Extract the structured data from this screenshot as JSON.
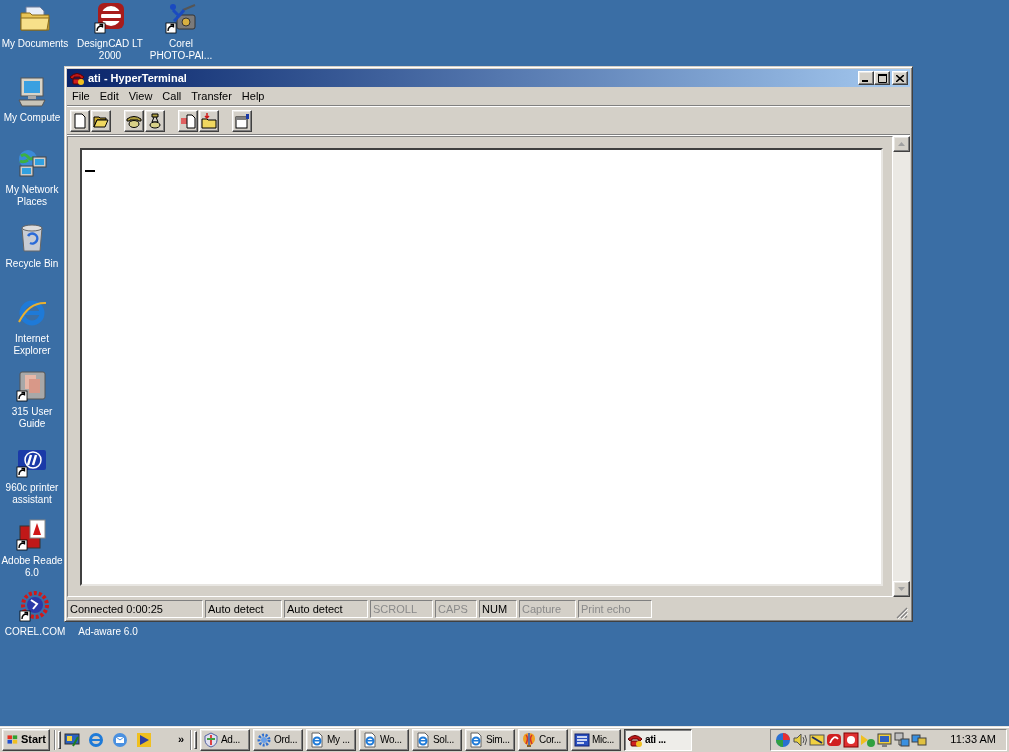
{
  "desktop": {
    "icons": [
      {
        "label": "My Documents",
        "kind": "folder",
        "shortcut": false
      },
      {
        "label": "DesignCAD LT\n2000",
        "kind": "cad",
        "shortcut": true
      },
      {
        "label": "Corel\nPHOTO-PAI...",
        "kind": "camera",
        "shortcut": true
      },
      {
        "label": "My Compute",
        "kind": "computer",
        "shortcut": false
      },
      {
        "label": "My Network\nPlaces",
        "kind": "network",
        "shortcut": false
      },
      {
        "label": "Recycle Bin",
        "kind": "recycle",
        "shortcut": false
      },
      {
        "label": "Internet\nExplorer",
        "kind": "browser",
        "shortcut": false
      },
      {
        "label": "315 User\nGuide",
        "kind": "guide",
        "shortcut": true
      },
      {
        "label": "960c printer\nassistant",
        "kind": "printer",
        "shortcut": true
      },
      {
        "label": "Adobe Reade\n6.0",
        "kind": "reader",
        "shortcut": true
      },
      {
        "label": "COREL.COM",
        "kind": "globe",
        "shortcut": true
      },
      {
        "label": "Ad-aware 6.0",
        "kind": "hidden"
      }
    ]
  },
  "window": {
    "title": "ati - HyperTerminal",
    "menu": [
      "File",
      "Edit",
      "View",
      "Call",
      "Transfer",
      "Help"
    ],
    "status_bar": [
      {
        "text": "Connected 0:00:25",
        "disabled": false
      },
      {
        "text": "Auto detect",
        "disabled": false
      },
      {
        "text": "Auto detect",
        "disabled": false
      },
      {
        "text": "SCROLL",
        "disabled": true
      },
      {
        "text": "CAPS",
        "disabled": true
      },
      {
        "text": "NUM",
        "disabled": false
      },
      {
        "text": "Capture",
        "disabled": true
      },
      {
        "text": "Print echo",
        "disabled": true
      }
    ]
  },
  "taskbar": {
    "start": "Start",
    "overflow": "»",
    "tasks": [
      {
        "label": "Ad...",
        "kind": "shield",
        "selected": false
      },
      {
        "label": "Ord...",
        "kind": "gear",
        "selected": false
      },
      {
        "label": "My ...",
        "kind": "webpage",
        "selected": false
      },
      {
        "label": "Wo...",
        "kind": "webpage",
        "selected": false
      },
      {
        "label": "Sol...",
        "kind": "webpage",
        "selected": false
      },
      {
        "label": "Sim...",
        "kind": "webpage",
        "selected": false
      },
      {
        "label": "Cor...",
        "kind": "balloon",
        "selected": false
      },
      {
        "label": "Mic...",
        "kind": "tile",
        "selected": false
      },
      {
        "label": "ati ...",
        "kind": "phone",
        "selected": true
      }
    ],
    "clock": "11:33 AM"
  }
}
